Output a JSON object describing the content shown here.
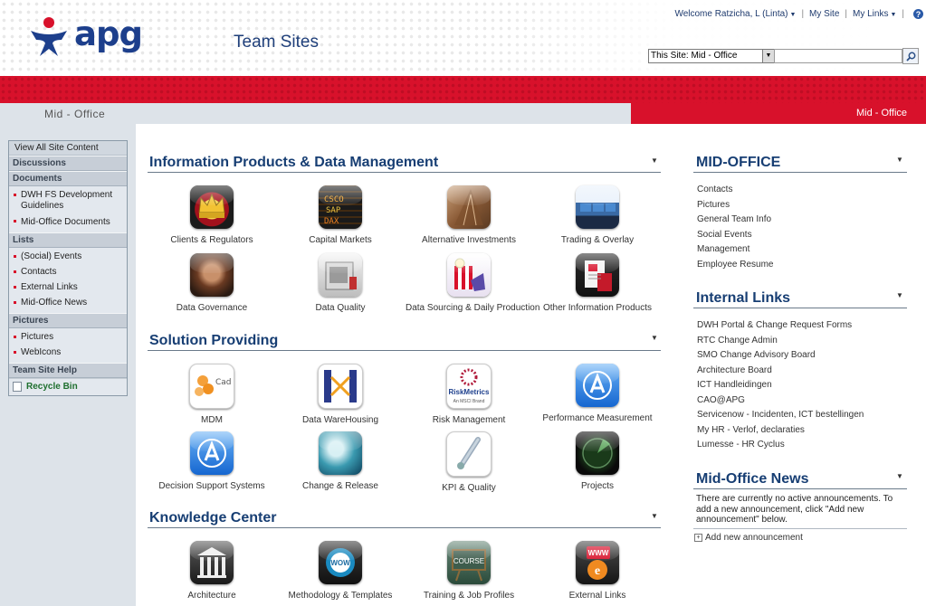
{
  "header": {
    "site_title": "Team Sites",
    "logo_text": "apg",
    "welcome": "Welcome Ratzicha, L (Linta)",
    "my_site": "My Site",
    "my_links": "My Links",
    "search_scope": "This Site: Mid - Office",
    "search_placeholder": ""
  },
  "breadcrumb": "Mid - Office",
  "tab_current": "Mid - Office",
  "quicklaunch": {
    "view_all": "View All Site Content",
    "headings": [
      "Discussions",
      "Documents",
      "Lists",
      "Pictures",
      "Team Site Help"
    ],
    "documents": [
      "DWH FS Development Guidelines",
      "Mid-Office Documents"
    ],
    "lists": [
      "(Social) Events",
      "Contacts",
      "External Links",
      "Mid-Office News"
    ],
    "pictures": [
      "Pictures",
      "WebIcons"
    ],
    "recycle_bin": "Recycle Bin"
  },
  "sections": [
    {
      "title": "Information Products & Data Management",
      "tiles": [
        {
          "label": "Clients & Regulators",
          "icon": "crown-icon"
        },
        {
          "label": "Capital Markets",
          "icon": "stock-board-icon"
        },
        {
          "label": "Alternative Investments",
          "icon": "building-icon"
        },
        {
          "label": "Trading & Overlay",
          "icon": "trading-desk-icon"
        },
        {
          "label": "Data Governance",
          "icon": "governance-figure-icon"
        },
        {
          "label": "Data Quality",
          "icon": "measuring-scale-icon"
        },
        {
          "label": "Data Sourcing & Daily Production",
          "icon": "popcorn-robot-icon"
        },
        {
          "label": "Other Information Products",
          "icon": "documents-icon"
        }
      ]
    },
    {
      "title": "Solution Providing",
      "tiles": [
        {
          "label": "MDM",
          "icon": "cad-molecule-icon"
        },
        {
          "label": "Data WareHousing",
          "icon": "warehouse-icon"
        },
        {
          "label": "Risk Management",
          "icon": "riskmetrics-icon",
          "icon_text": "RiskMetrics",
          "icon_subtext": "An MSCI Brand"
        },
        {
          "label": "Performance Measurement",
          "icon": "app-store-icon"
        },
        {
          "label": "Decision Support Systems",
          "icon": "app-store-icon"
        },
        {
          "label": "Change & Release",
          "icon": "wave-icon"
        },
        {
          "label": "KPI & Quality",
          "icon": "thermometer-icon"
        },
        {
          "label": "Projects",
          "icon": "radar-icon"
        }
      ]
    },
    {
      "title": "Knowledge Center",
      "tiles": [
        {
          "label": "Architecture",
          "icon": "columns-building-icon"
        },
        {
          "label": "Methodology & Templates",
          "icon": "wow-sticker-icon",
          "icon_text": "WOW"
        },
        {
          "label": "Training & Job Profiles",
          "icon": "course-board-icon",
          "icon_text": "COURSE"
        },
        {
          "label": "External Links",
          "icon": "browser-www-icon",
          "icon_text": "WWW"
        }
      ]
    }
  ],
  "right": {
    "mid_office": {
      "title": "MID-OFFICE",
      "links": [
        "Contacts",
        "Pictures",
        "General Team Info",
        "Social Events",
        "Management",
        "Employee Resume"
      ]
    },
    "internal_links": {
      "title": "Internal Links",
      "links": [
        "DWH Portal & Change Request Forms",
        "RTC Change Admin",
        "SMO Change Advisory Board",
        "Architecture Board",
        "ICT Handleidingen",
        "CAO@APG",
        "Servicenow - Incidenten, ICT bestellingen",
        "My HR - Verlof, declaraties",
        "Lumesse - HR Cyclus"
      ]
    },
    "news": {
      "title": "Mid-Office News",
      "empty_text": "There are currently no active announcements. To add a new announcement, click \"Add new announcement\" below.",
      "add_label": "Add new announcement"
    }
  },
  "colors": {
    "brand_red": "#d8112b",
    "brand_blue": "#1d3f8c",
    "section_title": "#173e73"
  }
}
